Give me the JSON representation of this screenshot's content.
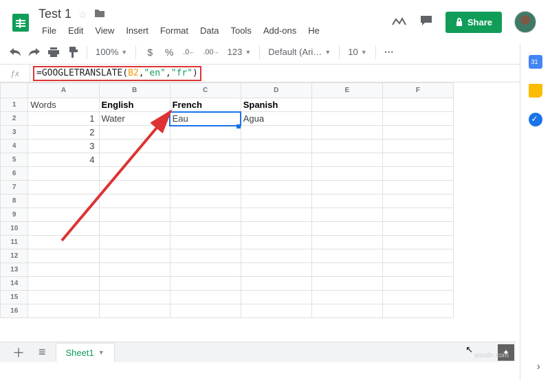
{
  "doc": {
    "title": "Test 1"
  },
  "menu": {
    "file": "File",
    "edit": "Edit",
    "view": "View",
    "insert": "Insert",
    "format": "Format",
    "data": "Data",
    "tools": "Tools",
    "addons": "Add-ons",
    "help": "He"
  },
  "share": {
    "label": "Share"
  },
  "toolbar": {
    "zoom": "100%",
    "currency": "$",
    "percent": "%",
    "dec_dec": ".0",
    "inc_dec": ".00",
    "more_formats": "123",
    "font": "Default (Ari…",
    "font_size": "10",
    "more": "⋯",
    "collapse": "˄"
  },
  "formula": {
    "eq": "=",
    "fn": "GOOGLETRANSLATE",
    "open": "(",
    "ref": "B2",
    "c1": ", ",
    "a1": "\"en\"",
    "c2": ", ",
    "a2": "\"fr\"",
    "close": ")"
  },
  "columns": [
    "A",
    "B",
    "C",
    "D",
    "E",
    "F"
  ],
  "rows": [
    "1",
    "2",
    "3",
    "4",
    "5",
    "6",
    "7",
    "8",
    "9",
    "10",
    "11",
    "12",
    "13",
    "14",
    "15",
    "16"
  ],
  "cells": {
    "A1": "Words",
    "B1": "English",
    "C1": "French",
    "D1": "Spanish",
    "A2": "1",
    "B2": "Water",
    "C2": "Eau",
    "D2": "Agua",
    "A3": "2",
    "A4": "3",
    "A5": "4"
  },
  "tabs": {
    "sheet1": "Sheet1"
  },
  "watermark": "wsxdn.com"
}
